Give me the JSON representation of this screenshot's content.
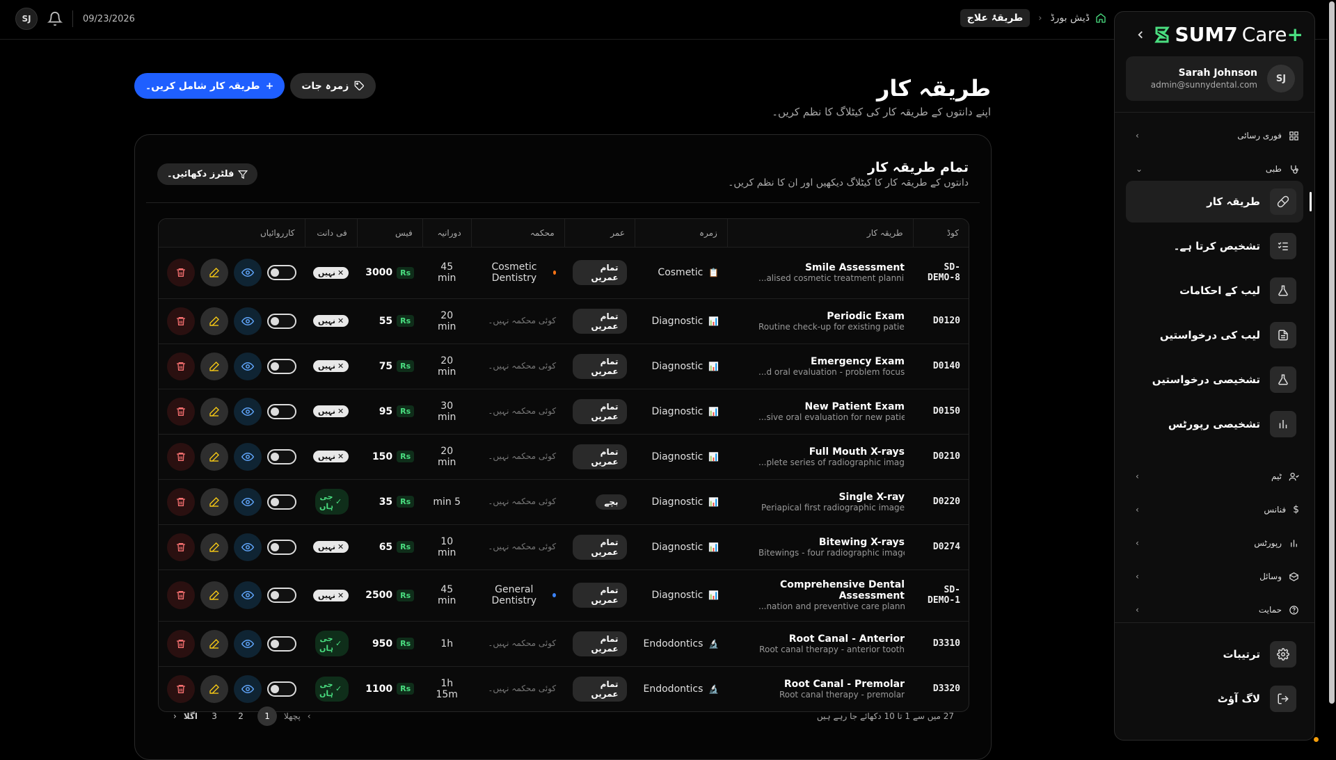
{
  "topbar": {
    "avatar": "SJ",
    "date": "09/23/2026"
  },
  "breadcrumb": {
    "home": "ڈیش بورڈ",
    "current": "طریقۂ علاج"
  },
  "header": {
    "title": "طریقہ کار",
    "subtitle": "اپنے دانتوں کے طریقہ کار کی کیٹلاگ کا نظم کریں۔",
    "add_label": "طریقہ کار شامل کریں۔",
    "categories_label": "زمرہ جات"
  },
  "card": {
    "title": "تمام طریقہ کار",
    "subtitle": "دانتوں کے طریقہ کار کا کیٹلاگ دیکھیں اور ان کا نظم کریں۔",
    "filter_label": "فلٹرز دکھائیں۔"
  },
  "table": {
    "columns": [
      "کوڈ",
      "طریقہ کار",
      "زمرہ",
      "عمر",
      "محکمہ",
      "دورانیہ",
      "فیس",
      "فی دانت",
      "کارروائیاں"
    ],
    "currency": "Rs",
    "rows": [
      {
        "code": "SD-DEMO-8",
        "name": "Smile Assessment",
        "desc": "...alised cosmetic treatment planning",
        "category": "Cosmetic",
        "cat_icon": "📋",
        "age": "تمام عمریں",
        "specialty": "Cosmetic Dentistry",
        "spec_color": "#f97316",
        "duration": "45 min",
        "fee": "3000",
        "per_tooth": "نہیں",
        "per_tooth_yes": false
      },
      {
        "code": "D0120",
        "name": "Periodic Exam",
        "desc": "Routine check-up for existing patient",
        "category": "Diagnostic",
        "cat_icon": "📊",
        "age": "تمام عمریں",
        "specialty": "کوئی محکمہ نہیں۔",
        "spec_color": "",
        "duration": "20 min",
        "fee": "55",
        "per_tooth": "نہیں",
        "per_tooth_yes": false
      },
      {
        "code": "D0140",
        "name": "Emergency Exam",
        "desc": "...d oral evaluation - problem focused",
        "category": "Diagnostic",
        "cat_icon": "📊",
        "age": "تمام عمریں",
        "specialty": "کوئی محکمہ نہیں۔",
        "spec_color": "",
        "duration": "20 min",
        "fee": "75",
        "per_tooth": "نہیں",
        "per_tooth_yes": false
      },
      {
        "code": "D0150",
        "name": "New Patient Exam",
        "desc": "...sive oral evaluation for new patient",
        "category": "Diagnostic",
        "cat_icon": "📊",
        "age": "تمام عمریں",
        "specialty": "کوئی محکمہ نہیں۔",
        "spec_color": "",
        "duration": "30 min",
        "fee": "95",
        "per_tooth": "نہیں",
        "per_tooth_yes": false
      },
      {
        "code": "D0210",
        "name": "Full Mouth X-rays",
        "desc": "...plete series of radiographic images",
        "category": "Diagnostic",
        "cat_icon": "📊",
        "age": "تمام عمریں",
        "specialty": "کوئی محکمہ نہیں۔",
        "spec_color": "",
        "duration": "20 min",
        "fee": "150",
        "per_tooth": "نہیں",
        "per_tooth_yes": false
      },
      {
        "code": "D0220",
        "name": "Single X-ray",
        "desc": "Periapical first radiographic image",
        "category": "Diagnostic",
        "cat_icon": "📊",
        "age": "بچے",
        "specialty": "کوئی محکمہ نہیں۔",
        "spec_color": "",
        "duration": "5 min",
        "fee": "35",
        "per_tooth": "جی ہاں",
        "per_tooth_yes": true
      },
      {
        "code": "D0274",
        "name": "Bitewing X-rays",
        "desc": "Bitewings - four radiographic images",
        "category": "Diagnostic",
        "cat_icon": "📊",
        "age": "تمام عمریں",
        "specialty": "کوئی محکمہ نہیں۔",
        "spec_color": "",
        "duration": "10 min",
        "fee": "65",
        "per_tooth": "نہیں",
        "per_tooth_yes": false
      },
      {
        "code": "SD-DEMO-1",
        "name": "Comprehensive Dental Assessment",
        "desc": "...nation and preventive care planning",
        "category": "Diagnostic",
        "cat_icon": "📊",
        "age": "تمام عمریں",
        "specialty": "General Dentistry",
        "spec_color": "#3b82f6",
        "duration": "45 min",
        "fee": "2500",
        "per_tooth": "نہیں",
        "per_tooth_yes": false
      },
      {
        "code": "D3310",
        "name": "Root Canal - Anterior",
        "desc": "Root canal therapy - anterior tooth",
        "category": "Endodontics",
        "cat_icon": "🔬",
        "age": "تمام عمریں",
        "specialty": "کوئی محکمہ نہیں۔",
        "spec_color": "",
        "duration": "1h",
        "fee": "950",
        "per_tooth": "جی ہاں",
        "per_tooth_yes": true
      },
      {
        "code": "D3320",
        "name": "Root Canal - Premolar",
        "desc": "Root canal therapy - premolar",
        "category": "Endodontics",
        "cat_icon": "🔬",
        "age": "تمام عمریں",
        "specialty": "کوئی محکمہ نہیں۔",
        "spec_color": "",
        "duration": "1h 15m",
        "fee": "1100",
        "per_tooth": "جی ہاں",
        "per_tooth_yes": true
      }
    ]
  },
  "pagination": {
    "summary": "27 میں سے 1 تا 10 دکھائے جا رہے ہیں",
    "prev": "پچھلا",
    "next": "اگلا",
    "pages": [
      "1",
      "2",
      "3"
    ],
    "current": "1"
  },
  "sidebar": {
    "logo_brand": "SUM7",
    "logo_care": "Care",
    "logo_plus": "+",
    "user": {
      "initials": "SJ",
      "name": "Sarah Johnson",
      "email": "admin@sunnydental.com"
    },
    "quick_access": "فوری رسائی",
    "medical": "طبی",
    "items": [
      {
        "label": "طریقہ کار",
        "icon": "bandage-icon",
        "active": true
      },
      {
        "label": "تشخیص کرتا ہے۔",
        "icon": "checklist-icon",
        "active": false
      },
      {
        "label": "لیب کے احکامات",
        "icon": "flask-icon",
        "active": false
      },
      {
        "label": "لیب کی درخواستیں",
        "icon": "document-icon",
        "active": false
      },
      {
        "label": "تشخیصی درخواستیں",
        "icon": "flask-icon",
        "active": false
      },
      {
        "label": "تشخیصی رپورٹس",
        "icon": "bar-chart-icon",
        "active": false
      }
    ],
    "sections": [
      "ٹیم",
      "فنانس",
      "رپورٹس",
      "وسائل",
      "حمایت"
    ],
    "settings": "ترتیبات",
    "logout": "لاگ آؤٹ"
  }
}
